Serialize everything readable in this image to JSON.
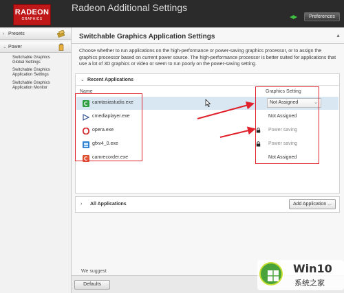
{
  "header": {
    "logo_line1": "RADEON",
    "logo_line2": "GRAPHICS",
    "title": "Radeon Additional Settings",
    "preferences_label": "Preferences"
  },
  "sidebar": {
    "presets_label": "Presets",
    "power_label": "Power",
    "items": [
      {
        "label_line1": "Switchable Graphics",
        "label_line2": "Global Settings"
      },
      {
        "label_line1": "Switchable Graphics",
        "label_line2": "Application Settings"
      },
      {
        "label_line1": "Switchable Graphics",
        "label_line2": "Application Monitor"
      }
    ]
  },
  "main": {
    "title": "Switchable Graphics Application Settings",
    "description": "Choose whether to run applications on the high-performance or power-saving graphics processor, or to assign the graphics processor based on current power source. The high-performance processor is better suited for applications that use a lot of 3D graphics or video or seem to run poorly on the power-saving setting.",
    "recent_section": {
      "label": "Recent Applications",
      "col_name": "Name",
      "col_setting": "Graphics Setting",
      "apps": [
        {
          "name": "camtasiastudio.exe",
          "setting": "Not Assigned",
          "icon": "camtasia-icon",
          "icon_color": "#2e9e3e"
        },
        {
          "name": "cmediaplayer.exe",
          "setting": "Not Assigned",
          "icon": "play-triangle-icon",
          "icon_color": "#2a4a8a"
        },
        {
          "name": "opera.exe",
          "setting": "Power saving",
          "icon": "opera-icon",
          "icon_color": "#d3252a"
        },
        {
          "name": "gfxv4_0.exe",
          "setting": "Power saving",
          "icon": "gfx-app-icon",
          "icon_color": "#2f7fd0"
        },
        {
          "name": "camrecorder.exe",
          "setting": "Not Assigned",
          "icon": "camrecorder-icon",
          "icon_color": "#e05030"
        }
      ]
    },
    "all_section": {
      "label": "All Applications",
      "add_button": "Add Application ..."
    },
    "suggest_text": "We suggest",
    "defaults_button": "Defaults"
  },
  "watermark": {
    "line1": "Win10",
    "line2": "系统之家"
  },
  "colors": {
    "annotation_red": "#e0202a",
    "selected_row": "#d9e7f3",
    "header_bg": "#2b2b2b",
    "brand_red": "#c01818"
  }
}
